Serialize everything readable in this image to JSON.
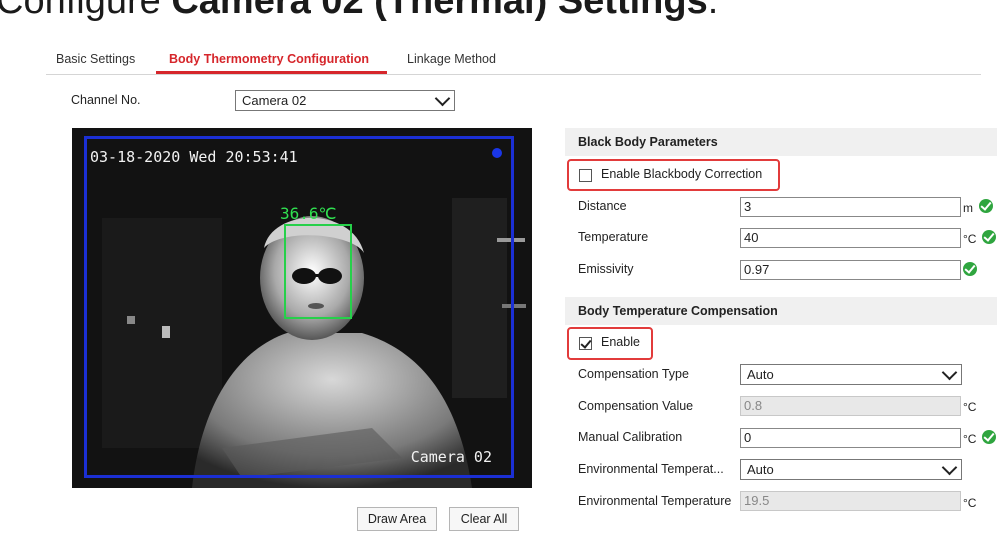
{
  "heading": {
    "prefix": "Configure ",
    "bold": "Camera 02 (Thermal) Settings",
    "suffix": "."
  },
  "tabs": [
    {
      "label": "Basic Settings"
    },
    {
      "label": "Body Thermometry Configuration"
    },
    {
      "label": "Linkage Method"
    }
  ],
  "channel": {
    "label": "Channel No.",
    "value": "Camera 02"
  },
  "video": {
    "timestamp": "03-18-2020 Wed 20:53:41",
    "camera_label": "Camera 02",
    "temperature": "36.6℃"
  },
  "buttons": {
    "draw_area": "Draw Area",
    "clear_all": "Clear All"
  },
  "blackbody": {
    "title": "Black Body Parameters",
    "enable_label": "Enable Blackbody Correction",
    "enable_checked": false,
    "fields": [
      {
        "label": "Distance",
        "value": "3",
        "unit": "m"
      },
      {
        "label": "Temperature",
        "value": "40",
        "unit": "°C"
      },
      {
        "label": "Emissivity",
        "value": "0.97",
        "unit": ""
      }
    ]
  },
  "compensation": {
    "title": "Body Temperature Compensation",
    "enable_label": "Enable",
    "enable_checked": true,
    "type_label": "Compensation Type",
    "type_value": "Auto",
    "value_label": "Compensation Value",
    "value_value": "0.8",
    "value_unit": "°C",
    "manual_label": "Manual Calibration",
    "manual_value": "0",
    "manual_unit": "°C",
    "env_mode_label": "Environmental Temperat...",
    "env_mode_value": "Auto",
    "env_temp_label": "Environmental Temperature",
    "env_temp_value": "19.5",
    "env_temp_unit": "°C"
  },
  "colors": {
    "accent": "#d6262b",
    "ok": "#2fa53f",
    "highlight": "#e23b3b"
  }
}
